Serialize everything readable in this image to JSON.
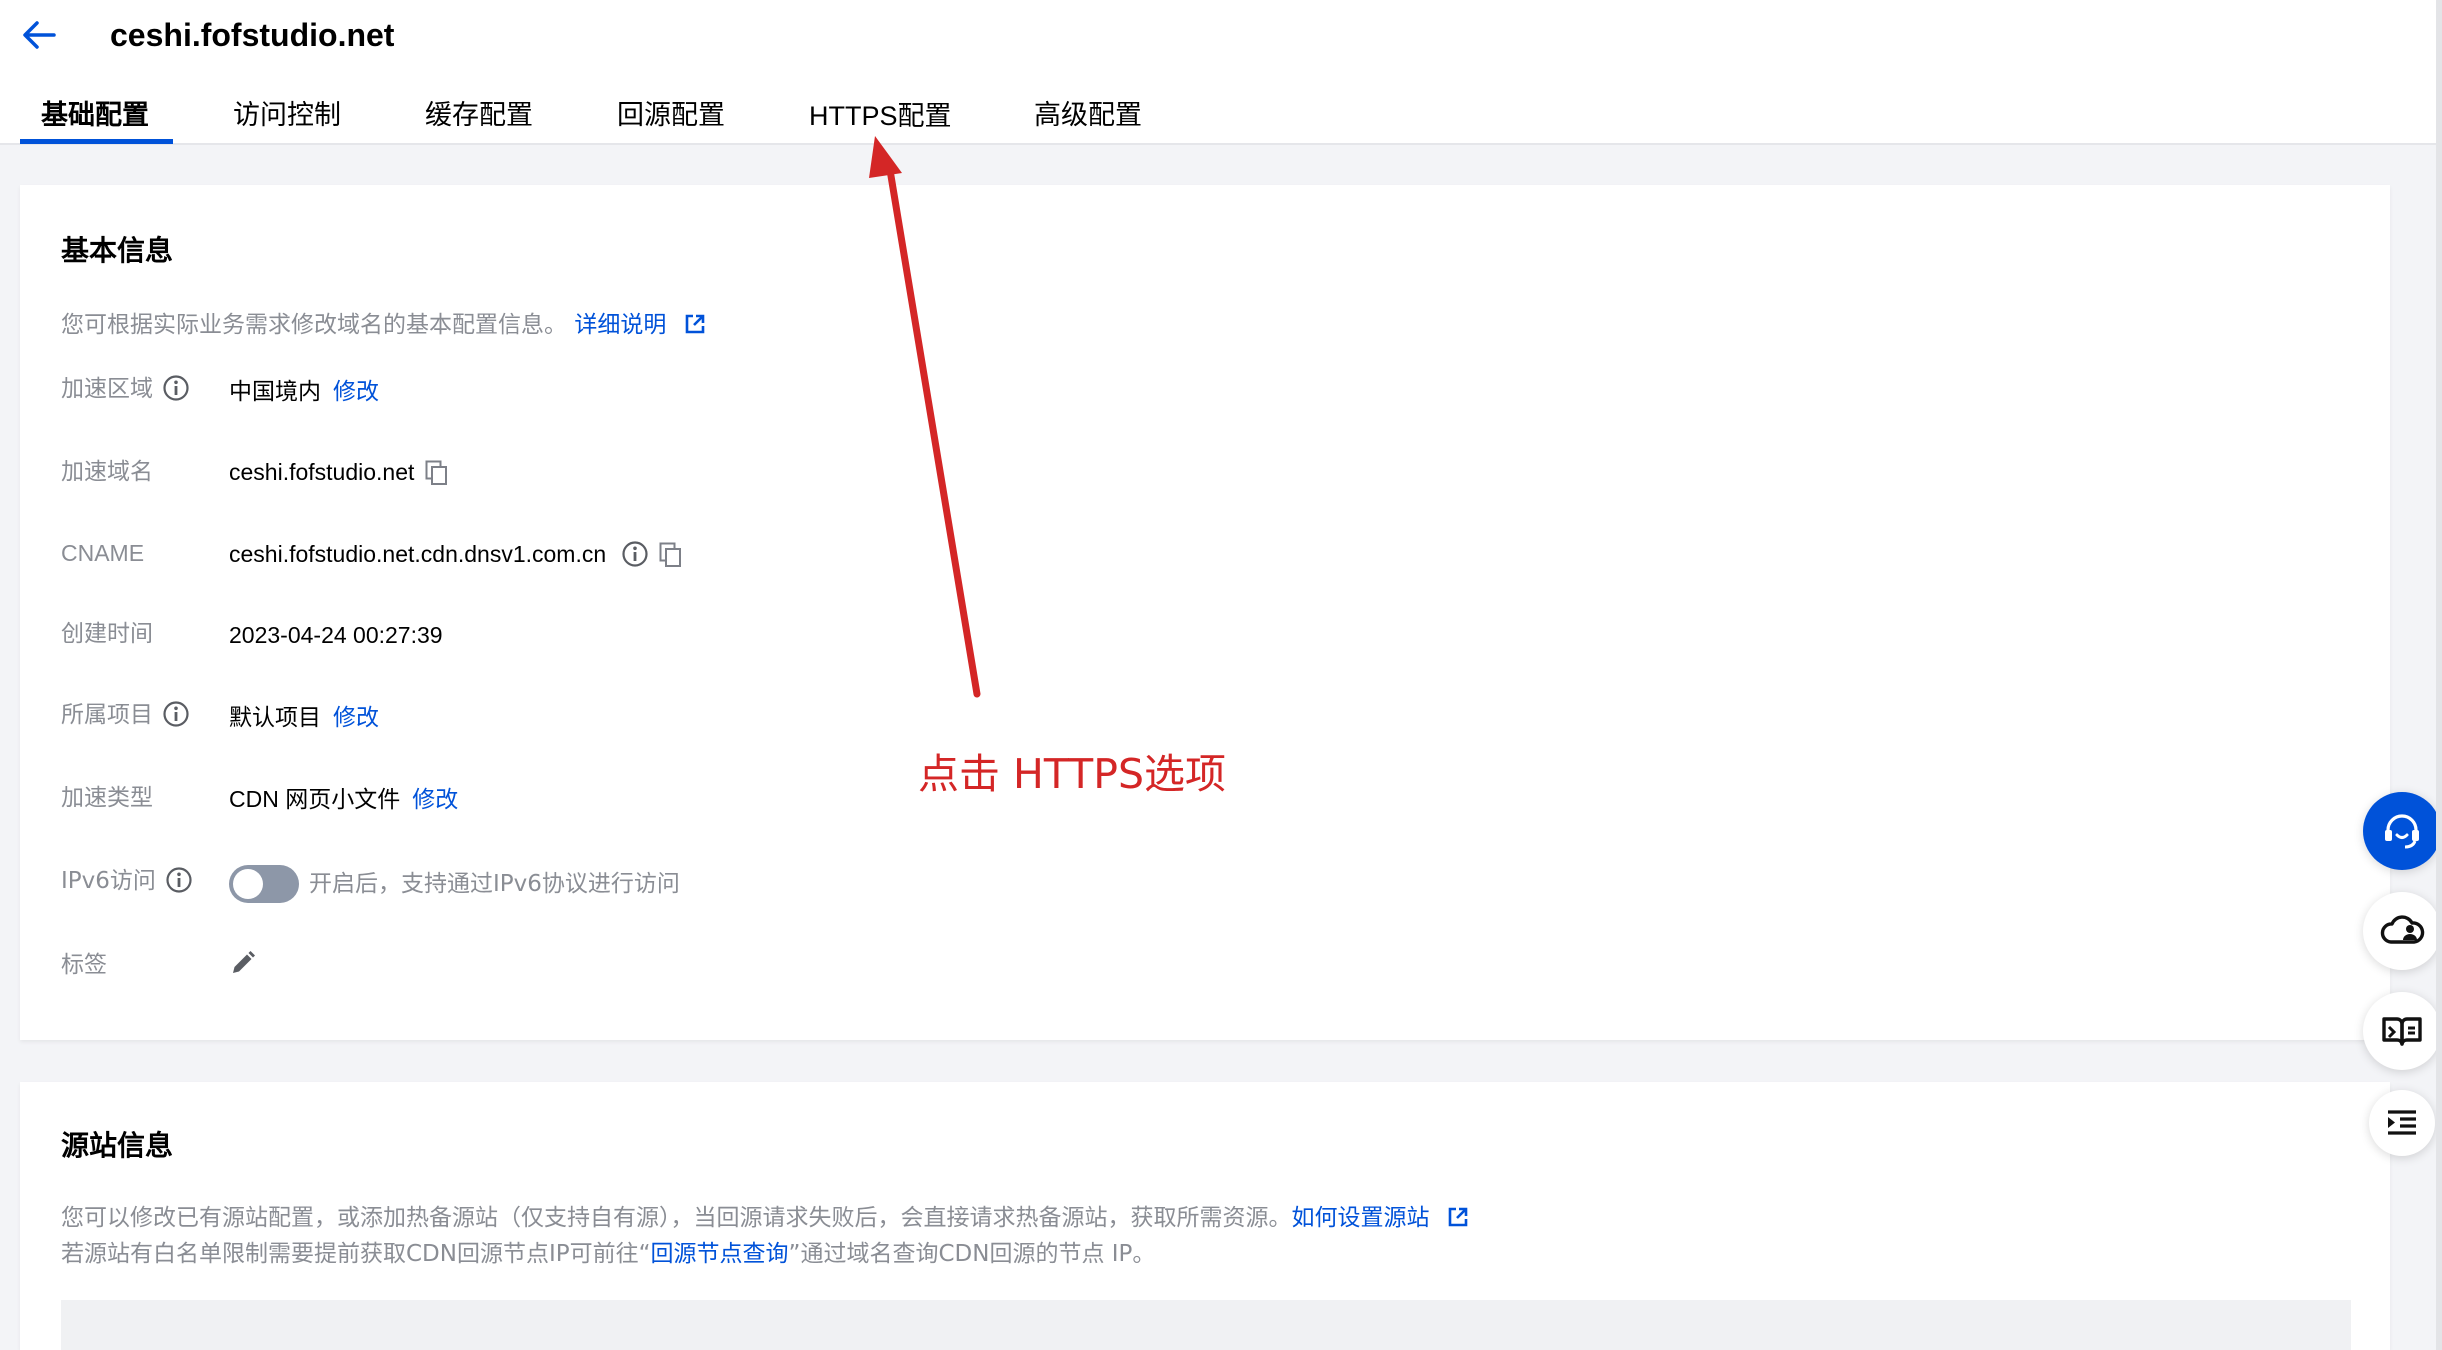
{
  "header": {
    "title": "ceshi.fofstudio.net",
    "tabs": [
      {
        "label": "基础配置",
        "active": true
      },
      {
        "label": "访问控制"
      },
      {
        "label": "缓存配置"
      },
      {
        "label": "回源配置"
      },
      {
        "label": "HTTPS配置"
      },
      {
        "label": "高级配置"
      }
    ]
  },
  "basic_info": {
    "title": "基本信息",
    "description": "您可根据实际业务需求修改域名的基本配置信息。",
    "description_link": "详细说明",
    "rows": {
      "region": {
        "label": "加速区域",
        "value": "中国境内",
        "action": "修改"
      },
      "domain": {
        "label": "加速域名",
        "value": "ceshi.fofstudio.net"
      },
      "cname": {
        "label": "CNAME",
        "value": "ceshi.fofstudio.net.cdn.dnsv1.com.cn"
      },
      "created": {
        "label": "创建时间",
        "value": "2023-04-24 00:27:39"
      },
      "project": {
        "label": "所属项目",
        "value": "默认项目",
        "action": "修改"
      },
      "type": {
        "label": "加速类型",
        "value": "CDN 网页小文件",
        "action": "修改"
      },
      "ipv6": {
        "label": "IPv6访问",
        "hint": "开启后，支持通过IPv6协议进行访问",
        "enabled": false
      },
      "tags": {
        "label": "标签"
      }
    }
  },
  "origin_info": {
    "title": "源站信息",
    "line1": "您可以修改已有源站配置，或添加热备源站（仅支持自有源），当回源请求失败后，会直接请求热备源站，获取所需资源。",
    "line1_link": "如何设置源站",
    "line2_prefix": "若源站有白名单限制需要提前获取CDN回源节点IP可前往“",
    "line2_link": "回源节点查询",
    "line2_suffix": "”通过域名查询CDN回源的节点 IP。"
  },
  "annotation": {
    "text": "点击 HTTPS选项",
    "color": "#d42626"
  },
  "floating_buttons": [
    "headset-icon",
    "cloud-user-icon",
    "book-icon",
    "list-indent-icon"
  ],
  "colors": {
    "accent": "#0052d9",
    "annotation": "#d42626"
  }
}
